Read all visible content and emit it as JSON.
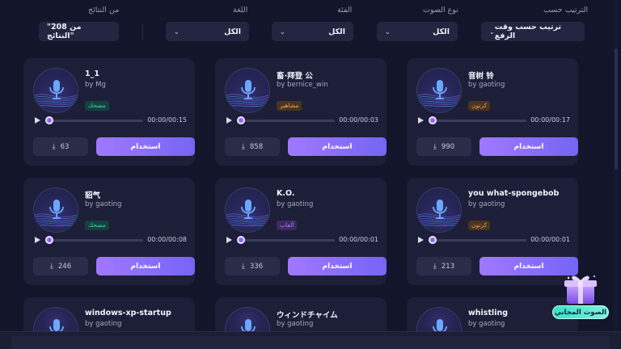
{
  "filters": {
    "sort": {
      "label": "الترتيب حسب",
      "value": "ترتيب حسب وقت الرفع"
    },
    "voice_type": {
      "label": "نوع الصوت",
      "value": "الكل"
    },
    "category": {
      "label": "الفئة",
      "value": "الكل"
    },
    "language": {
      "label": "اللغة",
      "value": "الكل"
    },
    "results": {
      "label": "من النتائج",
      "value": "\"208 من النتائج\""
    }
  },
  "cards": [
    {
      "title": "1_1",
      "author": "by Mg",
      "tag": "مضحك",
      "time": "00:00/00:15",
      "downloads": "63",
      "use_label": "استخدام"
    },
    {
      "title": "畜·拜登 公",
      "author": "by bernice_win",
      "tag": "مشاهير",
      "time": "00:00/00:03",
      "downloads": "858",
      "use_label": "استخدام"
    },
    {
      "title": "音树 铃",
      "author": "by gaoting",
      "tag": "كرتون",
      "time": "00:00/00:17",
      "downloads": "990",
      "use_label": "استخدام"
    },
    {
      "title": "貂气",
      "author": "by gaoting",
      "tag": "مضحك",
      "time": "00:00/00:08",
      "downloads": "246",
      "use_label": "استخدام"
    },
    {
      "title": "K.O.",
      "author": "by gaoting",
      "tag": "ألعاب",
      "time": "00:00/00:01",
      "downloads": "336",
      "use_label": "استخدام"
    },
    {
      "title": "you what-spongebob",
      "author": "by gaoting",
      "tag": "كرتون",
      "time": "00:00/00:01",
      "downloads": "213",
      "use_label": "استخدام"
    },
    {
      "title": "windows-xp-startup",
      "author": "by gaoting"
    },
    {
      "title": "ウィンドチャイム",
      "author": "by gaoting"
    },
    {
      "title": "whistling",
      "author": "by gaoting"
    }
  ],
  "free_voice": {
    "label": "الصوت المجاني"
  },
  "colors": {
    "accent": "#8f63ff",
    "tag_funny": "#4ad0a8",
    "tag_celebrity": "#e8a35a",
    "tag_games": "#a77cf0",
    "free_badge": "#39e0c8"
  },
  "icons": {
    "avatar": "microphone-icon",
    "play": "play-icon",
    "download": "download-icon",
    "chevron": "chevron-down-icon",
    "gift": "gift-icon"
  }
}
